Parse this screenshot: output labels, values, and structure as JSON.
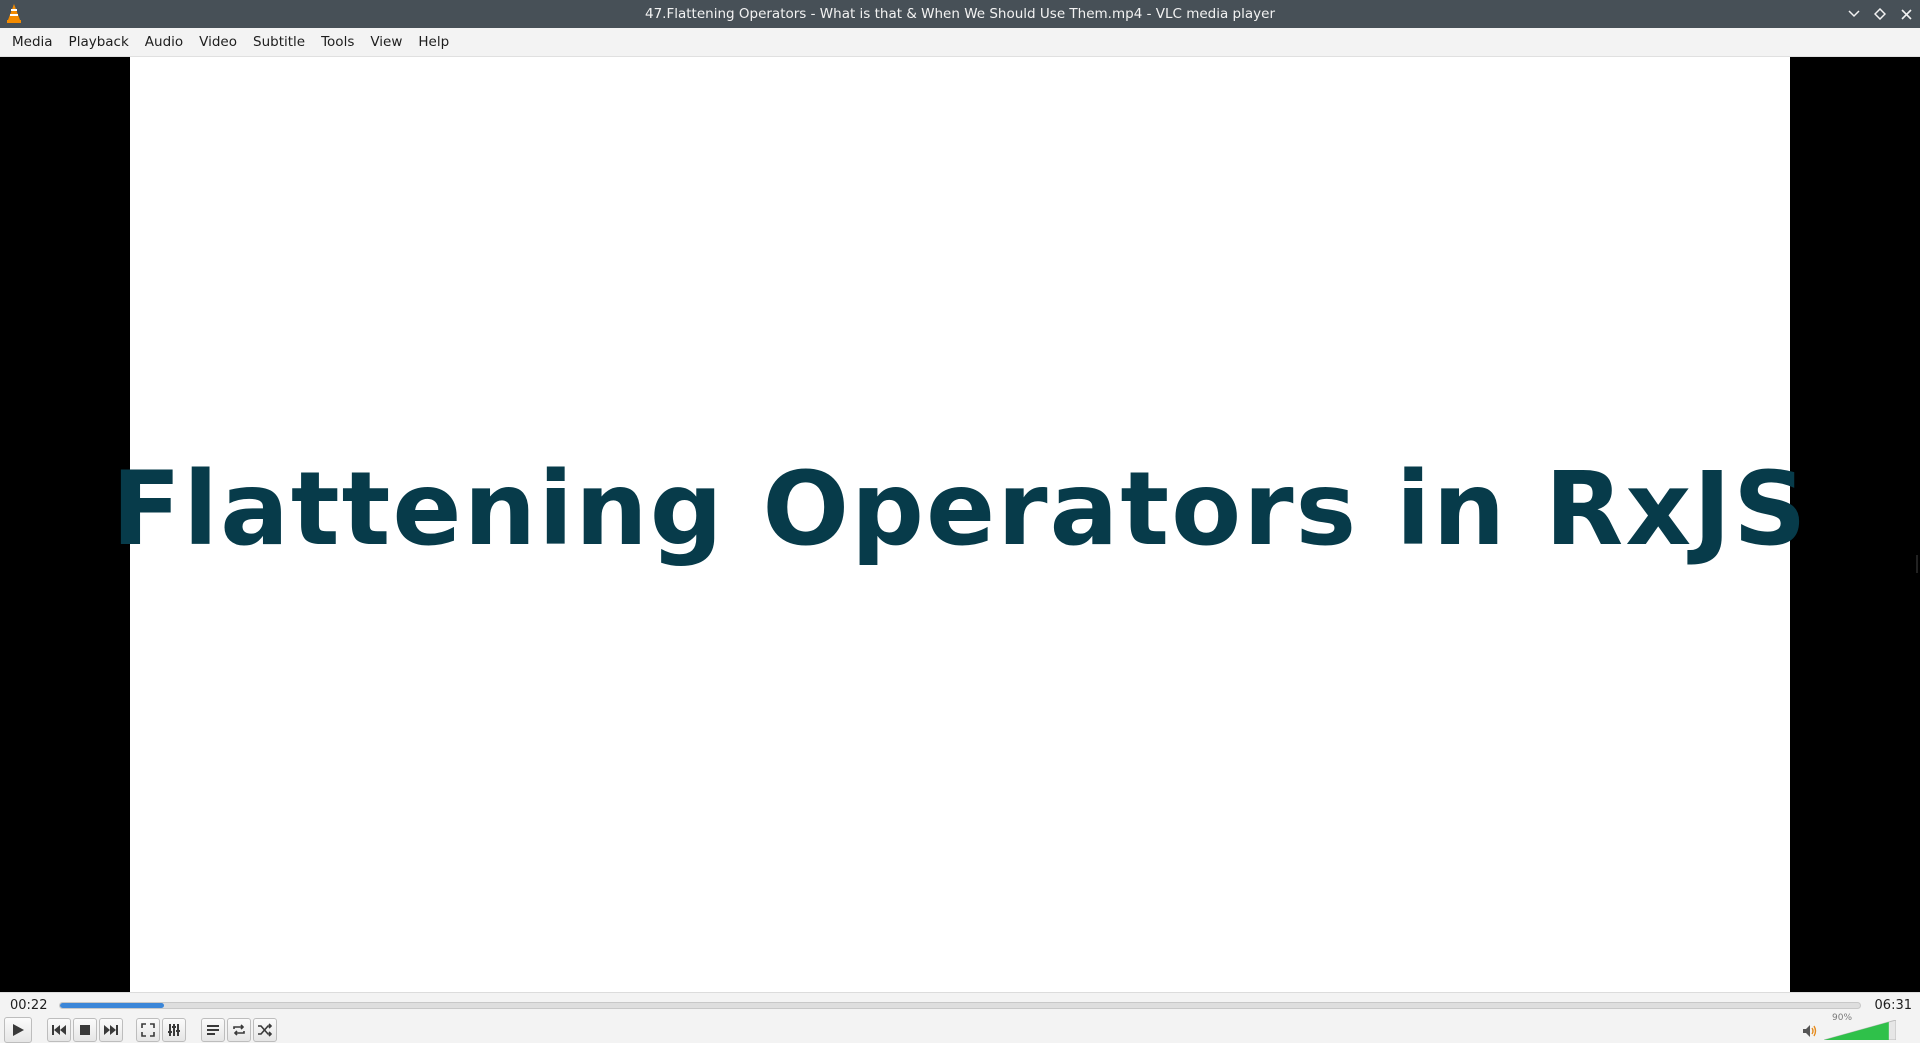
{
  "window": {
    "title": "47.Flattening Operators - What is that & When We Should Use Them.mp4 - VLC media player"
  },
  "menu": [
    "Media",
    "Playback",
    "Audio",
    "Video",
    "Subtitle",
    "Tools",
    "View",
    "Help"
  ],
  "video": {
    "slide_title": "Flattening Operators in RxJS"
  },
  "playback": {
    "elapsed": "00:22",
    "total": "06:31",
    "progress_fraction": 0.058
  },
  "volume": {
    "label": "90%",
    "level_fraction": 0.9
  },
  "colors": {
    "titlebar": "#475057",
    "slide_text": "#073b4a",
    "seek_fill": "#3b86d8",
    "volume_fill": "#2fc14a"
  }
}
